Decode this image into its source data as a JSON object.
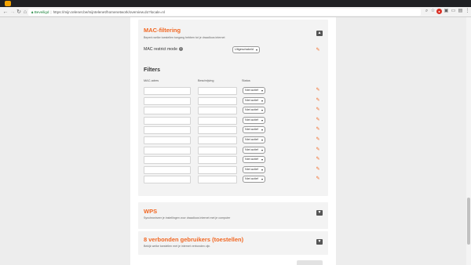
{
  "browser": {
    "secure_label": "Beveiligd",
    "url": "https://mijn.telenet.be/mijntelenet/homenetwork/overview.do?locale=nl"
  },
  "mac": {
    "title": "MAC-filtering",
    "subtitle": "Beperk welke toestellen toegang hebben tot je draadloos internet",
    "restrict_label": "MAC restrict mode",
    "restrict_value": "Uitgeschakeld"
  },
  "filters": {
    "heading": "Filters",
    "col_mac": "MAC-adres",
    "col_desc": "Beschrijving",
    "col_status": "Status",
    "rows": [
      {
        "mac": "",
        "desc": "",
        "status": "Niet actief"
      },
      {
        "mac": "",
        "desc": "",
        "status": "Niet actief"
      },
      {
        "mac": "",
        "desc": "",
        "status": "Niet actief"
      },
      {
        "mac": "",
        "desc": "",
        "status": "Niet actief"
      },
      {
        "mac": "",
        "desc": "",
        "status": "Niet actief"
      },
      {
        "mac": "",
        "desc": "",
        "status": "Niet actief"
      },
      {
        "mac": "",
        "desc": "",
        "status": "Niet actief"
      },
      {
        "mac": "",
        "desc": "",
        "status": "Niet actief"
      },
      {
        "mac": "",
        "desc": "",
        "status": "Niet actief"
      },
      {
        "mac": "",
        "desc": "",
        "status": "Niet actief"
      }
    ]
  },
  "wps": {
    "title": "WPS",
    "subtitle": "Synchroniseer je instellingen voor draadloos internet met je computer"
  },
  "devices": {
    "title": "8 verbonden gebruikers (toestellen)",
    "subtitle": "Bekijk welke toestellen met je internet verbonden zijn."
  },
  "colors": {
    "accent": "#f26722",
    "card": "#f3f3f3"
  },
  "icons": {
    "edit": "edit-icon",
    "collapse": "chevron-up-icon",
    "expand": "chevron-down-icon"
  }
}
